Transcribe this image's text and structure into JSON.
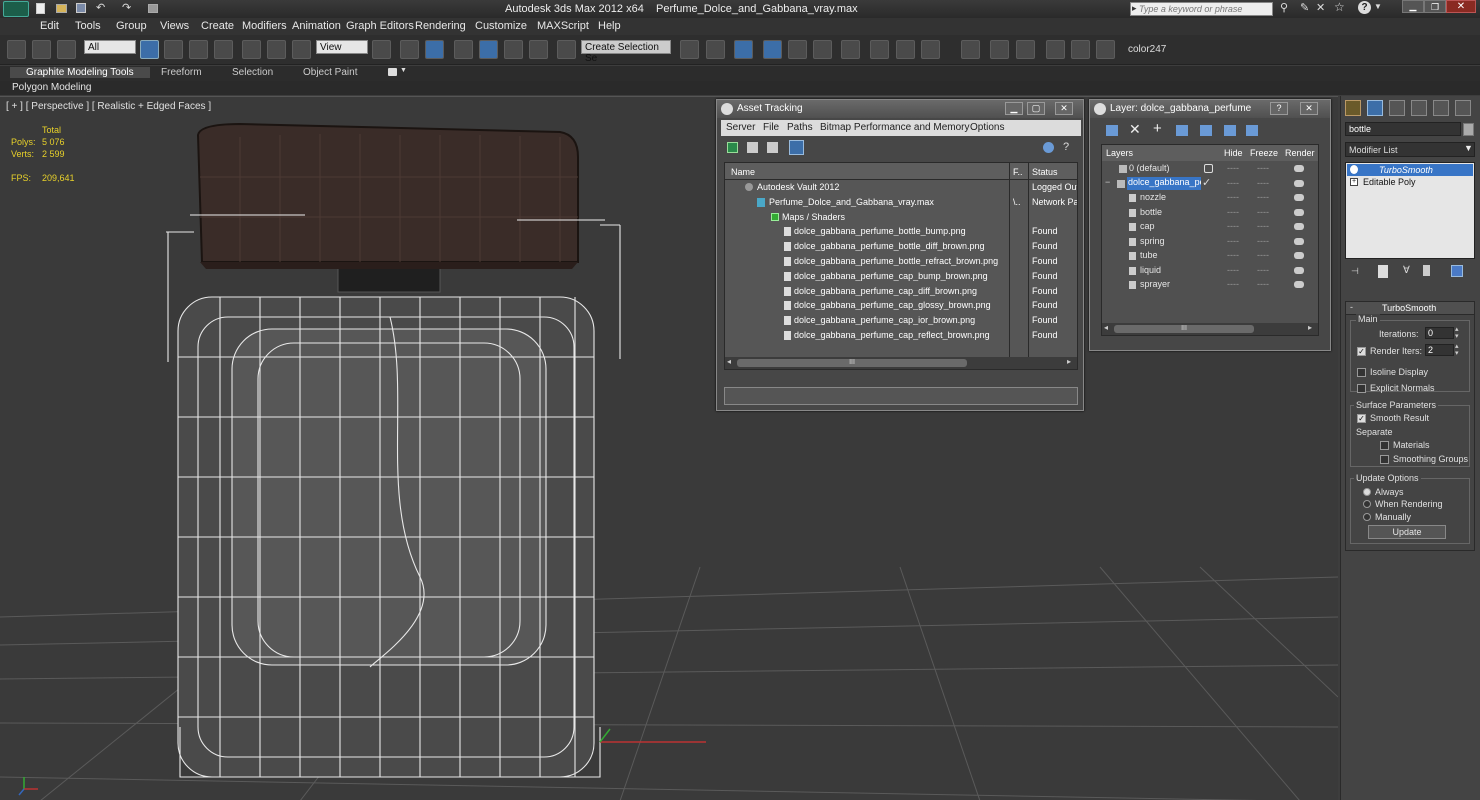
{
  "titlebar": {
    "app": "Autodesk 3ds Max  2012 x64",
    "file": "Perfume_Dolce_and_Gabbana_vray.max",
    "search_placeholder": "Type a keyword or phrase"
  },
  "menu": [
    "Edit",
    "Tools",
    "Group",
    "Views",
    "Create",
    "Modifiers",
    "Animation",
    "Graph Editors",
    "Rendering",
    "Customize",
    "MAXScript",
    "Help"
  ],
  "toolbar": {
    "selection_filter": "All",
    "ref_coord": "View",
    "named_selection": "Create Selection Se",
    "color_label": "color247"
  },
  "ribbon": {
    "tabs": [
      "Graphite Modeling Tools",
      "Freeform",
      "Selection",
      "Object Paint"
    ],
    "subtab": "Polygon Modeling"
  },
  "viewport": {
    "label": "[ + ] [ Perspective ] [ Realistic + Edged Faces ]",
    "stats": {
      "total_label": "Total",
      "polys_label": "Polys:",
      "polys": "5 076",
      "verts_label": "Verts:",
      "verts": "2 599",
      "fps_label": "FPS:",
      "fps": "209,641"
    }
  },
  "asset_tracking": {
    "title": "Asset Tracking",
    "menu": [
      "Server",
      "File",
      "Paths",
      "Bitmap Performance and Memory",
      "Options"
    ],
    "columns": {
      "name": "Name",
      "f": "F..",
      "status": "Status"
    },
    "rows": [
      {
        "name": "Autodesk Vault 2012",
        "f": "",
        "status": "Logged Out"
      },
      {
        "name": "Perfume_Dolce_and_Gabbana_vray.max",
        "f": "\\..",
        "status": "Network Pa"
      },
      {
        "name": "Maps / Shaders",
        "f": "",
        "status": ""
      },
      {
        "name": "dolce_gabbana_perfume_bottle_bump.png",
        "f": "",
        "status": "Found"
      },
      {
        "name": "dolce_gabbana_perfume_bottle_diff_brown.png",
        "f": "",
        "status": "Found"
      },
      {
        "name": "dolce_gabbana_perfume_bottle_refract_brown.png",
        "f": "",
        "status": "Found"
      },
      {
        "name": "dolce_gabbana_perfume_cap_bump_brown.png",
        "f": "",
        "status": "Found"
      },
      {
        "name": "dolce_gabbana_perfume_cap_diff_brown.png",
        "f": "",
        "status": "Found"
      },
      {
        "name": "dolce_gabbana_perfume_cap_glossy_brown.png",
        "f": "",
        "status": "Found"
      },
      {
        "name": "dolce_gabbana_perfume_cap_ior_brown.png",
        "f": "",
        "status": "Found"
      },
      {
        "name": "dolce_gabbana_perfume_cap_reflect_brown.png",
        "f": "",
        "status": "Found"
      }
    ],
    "scroll_grip": "III"
  },
  "layer_window": {
    "title": "Layer: dolce_gabbana_perfume",
    "columns": {
      "layers": "Layers",
      "hide": "Hide",
      "freeze": "Freeze",
      "render": "Render"
    },
    "rows": [
      {
        "name": "0 (default)",
        "hide": "----",
        "freeze": "----"
      },
      {
        "name": "dolce_gabbana_pe",
        "hide": "----",
        "freeze": "----"
      },
      {
        "name": "nozzle",
        "hide": "----",
        "freeze": "----"
      },
      {
        "name": "bottle",
        "hide": "----",
        "freeze": "----"
      },
      {
        "name": "cap",
        "hide": "----",
        "freeze": "----"
      },
      {
        "name": "spring",
        "hide": "----",
        "freeze": "----"
      },
      {
        "name": "tube",
        "hide": "----",
        "freeze": "----"
      },
      {
        "name": "liquid",
        "hide": "----",
        "freeze": "----"
      },
      {
        "name": "sprayer",
        "hide": "----",
        "freeze": "----"
      }
    ],
    "scroll_grip": "III"
  },
  "command_panel": {
    "object_name": "bottle",
    "modifier_list": "Modifier List",
    "stack": [
      "TurboSmooth",
      "Editable Poly"
    ],
    "rollout_title": "TurboSmooth",
    "main_label": "Main",
    "iterations_label": "Iterations:",
    "iterations": "0",
    "render_iters_label": "Render Iters:",
    "render_iters": "2",
    "isoline": "Isoline Display",
    "explicit_normals": "Explicit Normals",
    "surface_params": "Surface Parameters",
    "smooth_result": "Smooth Result",
    "separate": "Separate",
    "materials": "Materials",
    "smoothing_groups": "Smoothing Groups",
    "update_options": "Update Options",
    "always": "Always",
    "when_rendering": "When Rendering",
    "manually": "Manually",
    "update_button": "Update"
  }
}
